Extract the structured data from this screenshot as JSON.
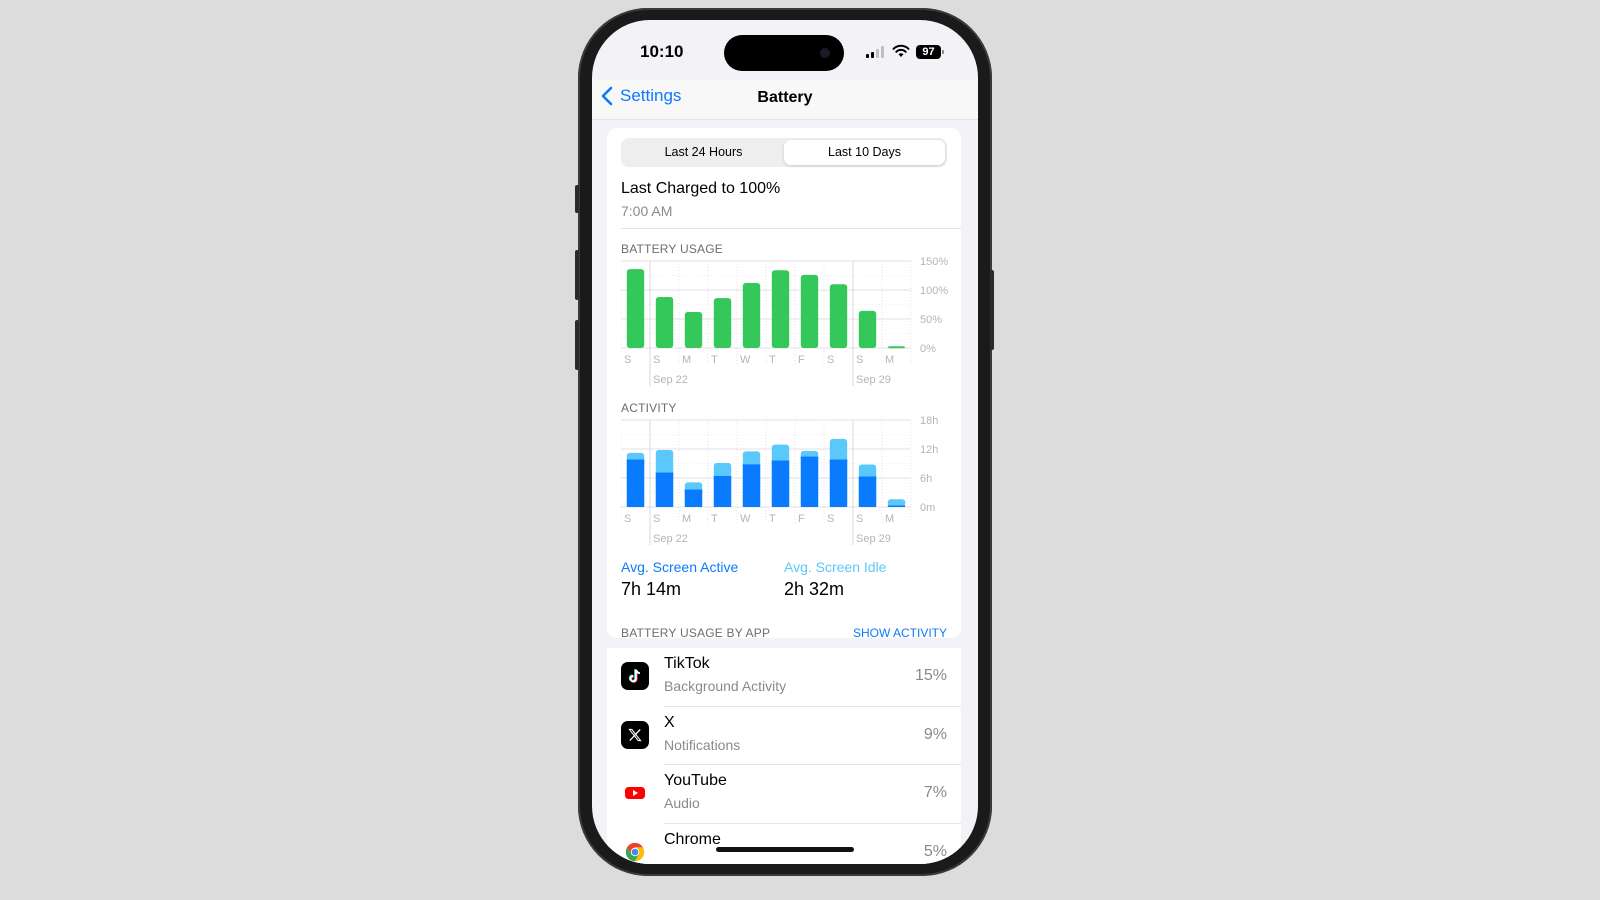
{
  "status_bar": {
    "time": "10:10",
    "battery_level": "97",
    "signal_bars": 2,
    "signal_total": 4
  },
  "nav": {
    "back_label": "Settings",
    "title": "Battery"
  },
  "segmented": {
    "options": [
      "Last 24 Hours",
      "Last 10 Days"
    ],
    "selected": "Last 10 Days"
  },
  "last_charged": {
    "title": "Last Charged to 100%",
    "time": "7:00 AM"
  },
  "colors": {
    "accent": "#0a7aff",
    "battery_bar": "#34c759",
    "active": "#0a7aff",
    "idle": "#5ac8fa"
  },
  "chart_data": [
    {
      "type": "bar",
      "title": "BATTERY USAGE",
      "categories": [
        "S",
        "S",
        "M",
        "T",
        "W",
        "T",
        "F",
        "S",
        "S",
        "M"
      ],
      "date_labels": [
        {
          "index": 1,
          "label": "Sep 22"
        },
        {
          "index": 8,
          "label": "Sep 29"
        }
      ],
      "values": [
        136,
        88,
        62,
        86,
        112,
        134,
        126,
        110,
        64,
        3
      ],
      "yticks": [
        "0%",
        "50%",
        "100%",
        "150%"
      ],
      "ylim": [
        0,
        150
      ],
      "unit": "%",
      "grid": true
    },
    {
      "type": "bar",
      "stacked": true,
      "title": "ACTIVITY",
      "categories": [
        "S",
        "S",
        "M",
        "T",
        "W",
        "T",
        "F",
        "S",
        "S",
        "M"
      ],
      "date_labels": [
        {
          "index": 1,
          "label": "Sep 22"
        },
        {
          "index": 8,
          "label": "Sep 29"
        }
      ],
      "series": [
        {
          "name": "Screen Active",
          "values": [
            9.8,
            7.1,
            3.6,
            6.4,
            8.8,
            9.6,
            10.4,
            9.8,
            6.3,
            0.3
          ]
        },
        {
          "name": "Screen Idle",
          "values": [
            1.4,
            4.7,
            1.5,
            2.7,
            2.7,
            3.3,
            1.2,
            4.3,
            2.5,
            1.3
          ]
        }
      ],
      "yticks": [
        "0m",
        "6h",
        "12h",
        "18h"
      ],
      "ylim": [
        0,
        18
      ],
      "unit": "h",
      "grid": true
    }
  ],
  "averages": {
    "active_label": "Avg. Screen Active",
    "active_value": "7h 14m",
    "idle_label": "Avg. Screen Idle",
    "idle_value": "2h 32m"
  },
  "usage_by_app": {
    "header": "BATTERY USAGE BY APP",
    "action": "SHOW ACTIVITY",
    "apps": [
      {
        "name": "TikTok",
        "detail": "Background Activity",
        "percent": "15%",
        "icon": "tiktok-icon"
      },
      {
        "name": "X",
        "detail": "Notifications",
        "percent": "9%",
        "icon": "x-icon"
      },
      {
        "name": "YouTube",
        "detail": "Audio",
        "percent": "7%",
        "icon": "youtube-icon"
      },
      {
        "name": "Chrome",
        "detail": "",
        "percent": "5%",
        "icon": "chrome-icon"
      }
    ]
  }
}
